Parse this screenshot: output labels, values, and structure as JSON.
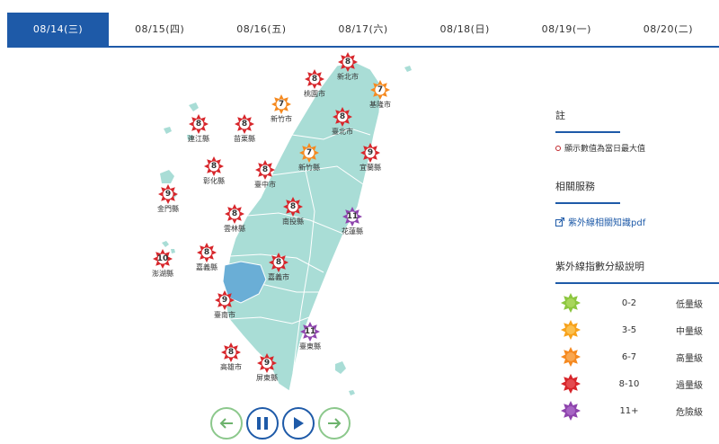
{
  "tabs": [
    {
      "label": "08/14(三)",
      "active": true
    },
    {
      "label": "08/15(四)",
      "active": false
    },
    {
      "label": "08/16(五)",
      "active": false
    },
    {
      "label": "08/17(六)",
      "active": false
    },
    {
      "label": "08/18(日)",
      "active": false
    },
    {
      "label": "08/19(一)",
      "active": false
    },
    {
      "label": "08/20(二)",
      "active": false
    }
  ],
  "markers": [
    {
      "name": "新北市",
      "value": "8",
      "level": "excessive"
    },
    {
      "name": "桃園市",
      "value": "8",
      "level": "excessive"
    },
    {
      "name": "基隆市",
      "value": "7",
      "level": "high"
    },
    {
      "name": "新竹市",
      "value": "7",
      "level": "high"
    },
    {
      "name": "臺北市",
      "value": "8",
      "level": "excessive"
    },
    {
      "name": "連江縣",
      "value": "8",
      "level": "excessive"
    },
    {
      "name": "苗栗縣",
      "value": "8",
      "level": "excessive"
    },
    {
      "name": "新竹縣",
      "value": "7",
      "level": "high"
    },
    {
      "name": "宜蘭縣",
      "value": "9",
      "level": "excessive"
    },
    {
      "name": "彰化縣",
      "value": "8",
      "level": "excessive"
    },
    {
      "name": "臺中市",
      "value": "8",
      "level": "excessive"
    },
    {
      "name": "金門縣",
      "value": "9",
      "level": "excessive"
    },
    {
      "name": "南投縣",
      "value": "8",
      "level": "excessive"
    },
    {
      "name": "雲林縣",
      "value": "8",
      "level": "excessive"
    },
    {
      "name": "花蓮縣",
      "value": "11",
      "level": "danger"
    },
    {
      "name": "澎湖縣",
      "value": "10",
      "level": "excessive"
    },
    {
      "name": "嘉義縣",
      "value": "8",
      "level": "excessive"
    },
    {
      "name": "嘉義市",
      "value": "8",
      "level": "excessive"
    },
    {
      "name": "臺南市",
      "value": "9",
      "level": "excessive"
    },
    {
      "name": "臺東縣",
      "value": "11",
      "level": "danger"
    },
    {
      "name": "高雄市",
      "value": "8",
      "level": "excessive"
    },
    {
      "name": "屏東縣",
      "value": "9",
      "level": "excessive"
    }
  ],
  "colors": {
    "low": "#8cc63f",
    "medium": "#f7a21b",
    "high": "#f5891f",
    "excessive": "#d7262b",
    "danger": "#8e44ad",
    "brand": "#1e5aa8",
    "map_fill": "#a9ddd6",
    "map_highlight": "#6aaed6"
  },
  "controls": {
    "prev": "arrow-left-icon",
    "pause": "pause-icon",
    "play": "play-icon",
    "next": "arrow-right-icon"
  },
  "sidebar": {
    "note_title": "註",
    "note_text": "顯示數值為當日最大值",
    "services_title": "相關服務",
    "services_link": "紫外線相關知識pdf",
    "legend_title": "紫外線指數分級說明",
    "legend": [
      {
        "range": "0-2",
        "level": "低量級",
        "key": "low"
      },
      {
        "range": "3-5",
        "level": "中量級",
        "key": "medium"
      },
      {
        "range": "6-7",
        "level": "高量級",
        "key": "high"
      },
      {
        "range": "8-10",
        "level": "過量級",
        "key": "excessive"
      },
      {
        "range": "11+",
        "level": "危險級",
        "key": "danger"
      }
    ]
  }
}
